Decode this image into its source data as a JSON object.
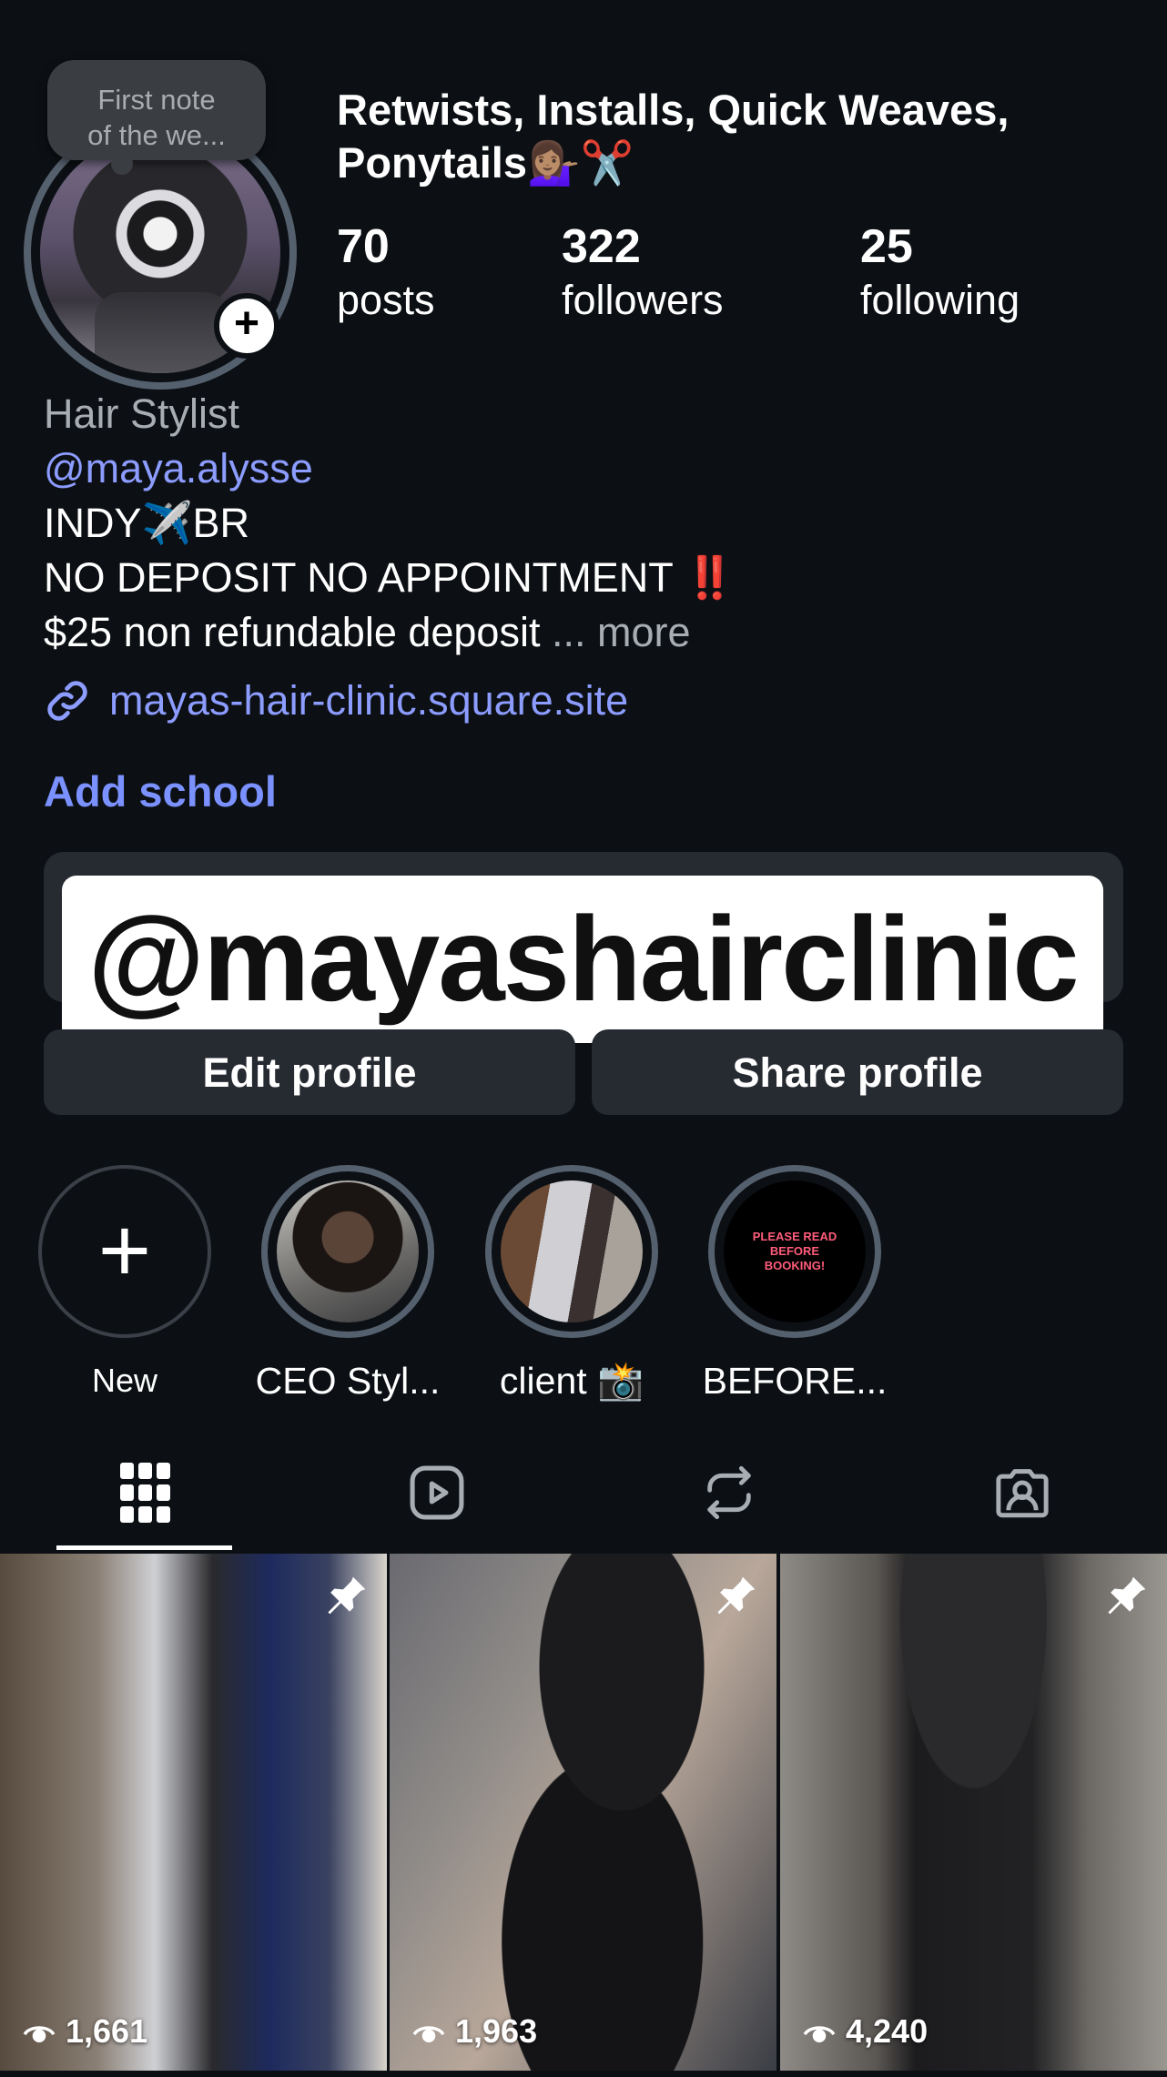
{
  "note": {
    "text_line1": "First note",
    "text_line2": "of the we..."
  },
  "profile": {
    "display_name": "Retwists, Installs, Quick Weaves, Ponytails💁🏽‍♀️✂️",
    "stats": {
      "posts": {
        "count": "70",
        "label": "posts"
      },
      "followers": {
        "count": "322",
        "label": "followers"
      },
      "following": {
        "count": "25",
        "label": "following"
      }
    }
  },
  "bio": {
    "category": "Hair Stylist",
    "handle": "@maya.alysse",
    "line1": "INDY✈️BR",
    "line2": "NO DEPOSIT NO APPOINTMENT ‼️",
    "line3": "$25 non refundable deposit",
    "more_label": "... more",
    "link": "mayas-hair-clinic.square.site",
    "add_school": "Add school"
  },
  "sticker": {
    "text": "@mayashairclinic"
  },
  "buttons": {
    "edit": "Edit profile",
    "share": "Share profile"
  },
  "highlights": [
    {
      "label": "New"
    },
    {
      "label": "CEO Styl..."
    },
    {
      "label": "client 📸"
    },
    {
      "label": "BEFORE...",
      "cover_text": "PLEASE READ BEFORE BOOKING!"
    }
  ],
  "tabs": [
    {
      "icon": "grid-icon",
      "active": true
    },
    {
      "icon": "reels-icon"
    },
    {
      "icon": "reposts-icon"
    },
    {
      "icon": "tagged-icon"
    }
  ],
  "posts": [
    {
      "views": "1,661",
      "pinned": true
    },
    {
      "views": "1,963",
      "pinned": true
    },
    {
      "views": "4,240",
      "pinned": true
    }
  ],
  "colors": {
    "background": "#0c1014",
    "link": "#8c9cff",
    "accent": "#7a91ff",
    "button": "#262a31"
  }
}
